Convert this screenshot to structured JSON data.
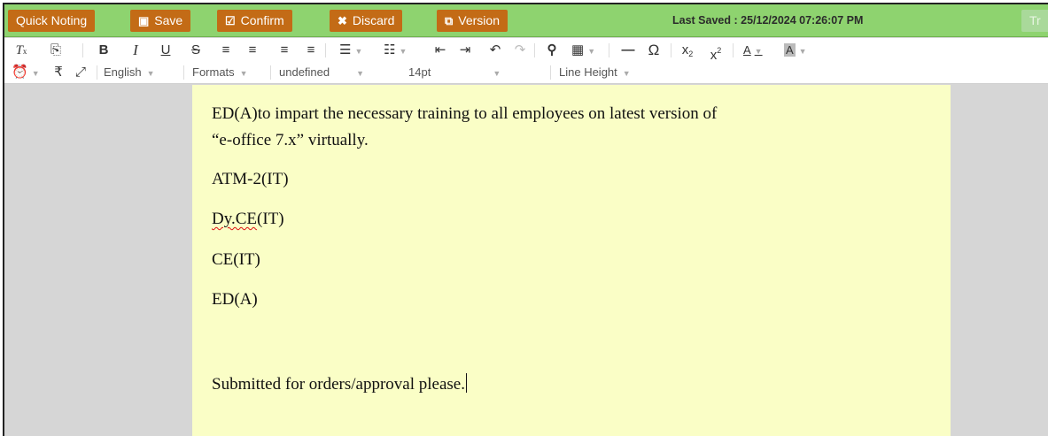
{
  "action_bar": {
    "quick_noting": "Quick Noting",
    "save": "Save",
    "confirm": "Confirm",
    "discard": "Discard",
    "version": "Version",
    "last_saved": "Last Saved : 25/12/2024 07:26:07 PM",
    "tr": "Tr"
  },
  "toolbar": {
    "language": "English",
    "formats": "Formats",
    "font_family": "undefined",
    "font_size": "14pt",
    "line_height": "Line Height",
    "rupee_symbol": "₹"
  },
  "document": {
    "line1": "ED(A)to impart the necessary training to all employees on latest version of",
    "line2": "“e-office 7.x” virtually.",
    "line3": "ATM-2(IT)",
    "line4_underlined": "Dy.CE",
    "line4_rest": "(IT)",
    "line5": "CE(IT)",
    "line6": "ED(A)",
    "line7": "Submitted for orders/approval please."
  },
  "colors": {
    "action_bar_bg": "#8ed36f",
    "button_bg": "#c36b16",
    "page_bg": "#fafec6",
    "editor_bg": "#d6d6d6"
  }
}
